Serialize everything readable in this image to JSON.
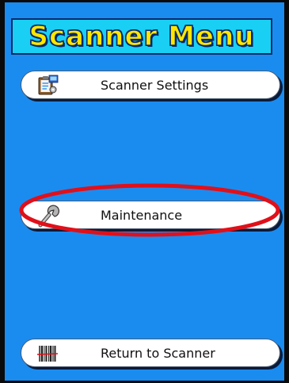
{
  "window": {
    "title": "Scanner Menu"
  },
  "menu": {
    "items": [
      {
        "label": "Scanner Settings",
        "icon": "settings-clipboard-icon"
      },
      {
        "label": "Maintenance",
        "icon": "wrench-icon"
      },
      {
        "label": "Return to Scanner",
        "icon": "barcode-icon"
      }
    ]
  },
  "colors": {
    "background": "#1a8cf0",
    "title_fill": "#19d0f4",
    "title_text": "#ffe600",
    "highlight": "#e0101a",
    "button_fill": "#ffffff"
  }
}
